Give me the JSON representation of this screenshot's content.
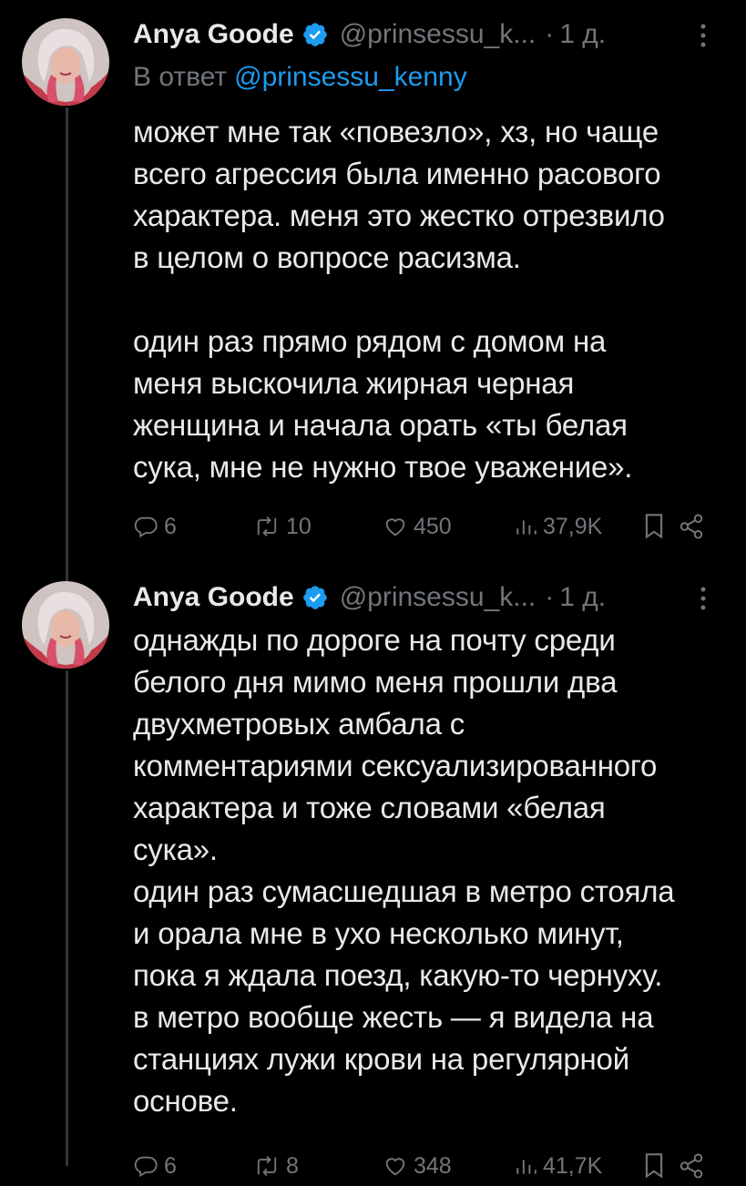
{
  "tweets": [
    {
      "author": {
        "name": "Anya Goode",
        "handle": "@prinsessu_k...",
        "verified": true
      },
      "separator": "·",
      "time": "1 д.",
      "reply_to": {
        "prefix": "В ответ",
        "mention": "@prinsessu_kenny"
      },
      "text": "может мне так «повезло», хз, но чаще\nвсего агрессия была именно расового\nхарактера. меня это жестко отрезвило\nв целом о вопросе расизма.\n\nодин раз прямо рядом с домом на\nменя выскочила жирная черная\nженщина и начала орать «ты белая\nсука, мне не нужно твое уважение».",
      "stats": {
        "replies": "6",
        "reposts": "10",
        "likes": "450",
        "views": "37,9K"
      }
    },
    {
      "author": {
        "name": "Anya Goode",
        "handle": "@prinsessu_k...",
        "verified": true
      },
      "separator": "·",
      "time": "1 д.",
      "text": "однажды по дороге на почту среди\nбелого дня мимо меня прошли два\nдвухметровых амбала с\nкомментариями сексуализированного\nхарактера и тоже словами «белая\nсука».\nодин раз сумасшедшая в метро стояла\nи орала мне в ухо несколько минут,\nпока я ждала поезд, какую-то чернуху.\nв метро вообще жесть — я видела на\nстанциях лужи крови на регулярной\nоснове.",
      "stats": {
        "replies": "6",
        "reposts": "8",
        "likes": "348",
        "views": "41,7K"
      }
    }
  ],
  "icons": {
    "verified": "verified-badge-icon",
    "more": "more-vertical-icon",
    "reply": "reply-icon",
    "repost": "repost-icon",
    "like": "like-icon",
    "views": "views-icon",
    "bookmark": "bookmark-icon",
    "share": "share-icon"
  },
  "colors": {
    "background": "#000000",
    "text": "#e7e9ea",
    "secondary": "#71767b",
    "link": "#1d9bf0",
    "thread_line": "#333639"
  }
}
